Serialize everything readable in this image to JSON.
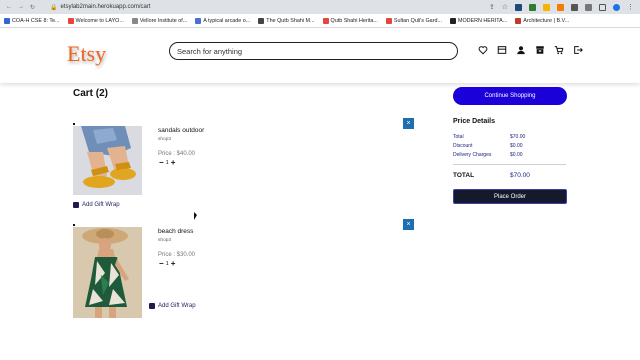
{
  "browser": {
    "url": "etsylab2main.herokuapp.com/cart",
    "bookmarks": [
      {
        "label": "COA-H CSE 8: Te...",
        "color": "#3367d6"
      },
      {
        "label": "Welcome to LAYO...",
        "color": "#e8453c"
      },
      {
        "label": "Vellore Institute of...",
        "color": "#888888"
      },
      {
        "label": "A typical arcade o...",
        "color": "#4a6fd6"
      },
      {
        "label": "The Qutb Shahi M...",
        "color": "#444444"
      },
      {
        "label": "Qutb Shahi Herita...",
        "color": "#e8453c"
      },
      {
        "label": "Sultan Quli's Gard...",
        "color": "#e8453c"
      },
      {
        "label": "MODERN HERITA...",
        "color": "#222222"
      },
      {
        "label": "Architecture | B.V...",
        "color": "#c0392b"
      }
    ]
  },
  "header": {
    "logo": "Etsy",
    "search_placeholder": "Search for anything",
    "icons": [
      "heart-icon",
      "orders-icon",
      "user-icon",
      "shop-icon",
      "cart-icon",
      "logout-icon"
    ]
  },
  "cart": {
    "title": "Cart (2)",
    "items": [
      {
        "name": "sandals outdoor",
        "shop": "shop3",
        "price": "Price : $40.00",
        "quantity": "1",
        "gift_label": "Add Gift Wrap"
      },
      {
        "name": "beach dress",
        "shop": "shop3",
        "price": "Price : $30.00",
        "quantity": "1",
        "gift_label": "Add Gift Wrap"
      }
    ],
    "remove_symbol": "×",
    "minus_symbol": "−",
    "plus_symbol": "+"
  },
  "summary": {
    "continue_label": "Continue Shopping",
    "title": "Price Details",
    "rows": [
      {
        "label": "Total",
        "value": "$70.00"
      },
      {
        "label": "Discount",
        "value": "$0.00"
      },
      {
        "label": "Delivery Charges",
        "value": "$0.00"
      }
    ],
    "total_label": "TOTAL",
    "total_value": "$70.00",
    "place_order_label": "Place Order"
  },
  "colors": {
    "brand": "#f1641e",
    "primary_button": "#1c00d9",
    "dark_button": "#141a2b",
    "remove_button": "#1d6fb1"
  }
}
